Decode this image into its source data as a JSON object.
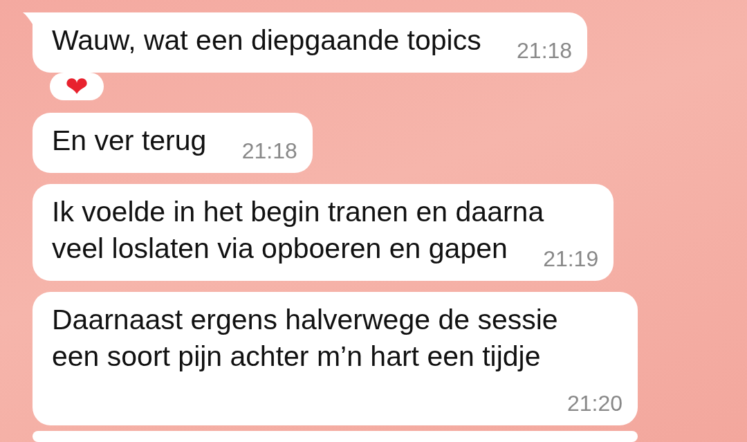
{
  "messages": [
    {
      "lines": [
        "Wauw, wat een diepgaande topics"
      ],
      "time": "21:18",
      "tail": true,
      "reaction": "❤"
    },
    {
      "lines": [
        "En ver terug"
      ],
      "time": "21:18",
      "tail": false
    },
    {
      "lines": [
        "Ik voelde in het begin tranen en daarna",
        "veel loslaten via opboeren en gapen"
      ],
      "time": "21:19",
      "tail": false
    },
    {
      "lines": [
        "Daarnaast ergens halverwege de sessie",
        "een soort pijn achter m’n hart een tijdje"
      ],
      "time": "21:20",
      "tail": false
    }
  ],
  "more_below": true
}
